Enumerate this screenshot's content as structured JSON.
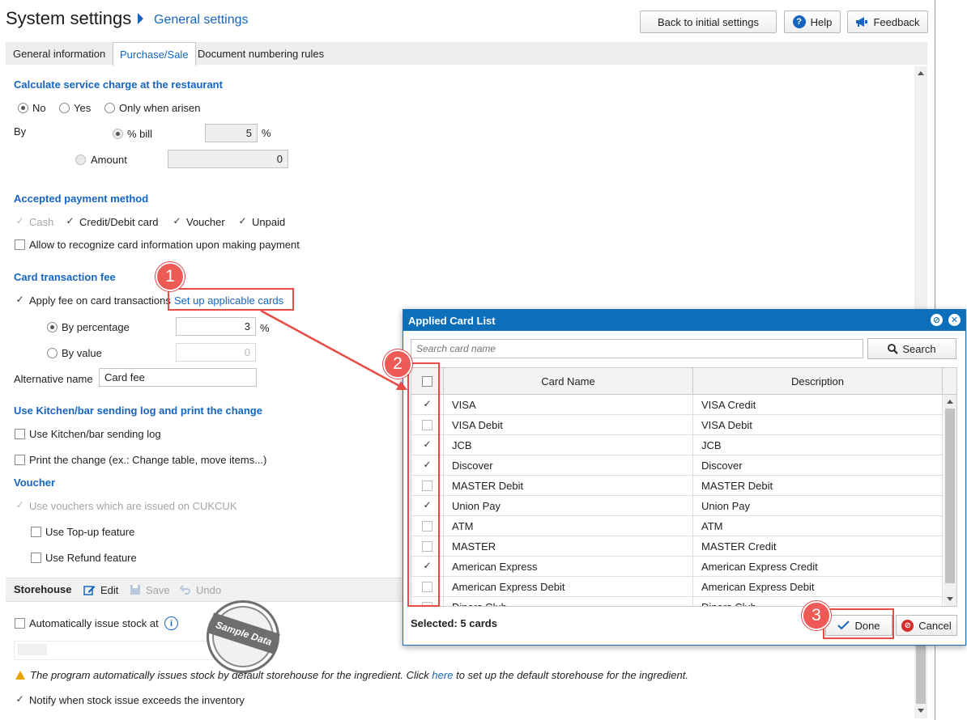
{
  "header": {
    "title": "System settings",
    "breadcrumb": "General settings",
    "back_label": "Back to initial settings",
    "help_label": "Help",
    "help_glyph": "?",
    "feedback_label": "Feedback"
  },
  "tabs": [
    "General information",
    "Purchase/Sale",
    "Document numbering rules"
  ],
  "service_charge": {
    "title": "Calculate service charge at the restaurant",
    "options": [
      "No",
      "Yes",
      "Only when arisen"
    ],
    "by_label": "By",
    "percent_label": "% bill",
    "percent_value": "5",
    "percent_unit": "%",
    "amount_label": "Amount",
    "amount_value": "0"
  },
  "payment": {
    "title": "Accepted payment method",
    "methods": [
      "Cash",
      "Credit/Debit card",
      "Voucher",
      "Unpaid"
    ],
    "recognize_label": "Allow to recognize card information upon making payment"
  },
  "card_fee": {
    "title": "Card transaction fee",
    "apply_label": "Apply fee on card transactions",
    "setup_link": "Set up applicable cards",
    "by_percentage": "By percentage",
    "percentage_value": "3",
    "percentage_unit": "%",
    "by_value": "By value",
    "value_value": "0",
    "alt_name_label": "Alternative name",
    "alt_name_value": "Card fee"
  },
  "kitchen": {
    "title": "Use Kitchen/bar sending log and print the change",
    "use_log": "Use Kitchen/bar sending log",
    "print_change": "Print the change (ex.: Change table, move items...)"
  },
  "voucher": {
    "title": "Voucher",
    "use_vouchers": "Use vouchers which are issued on CUKCUK",
    "topup": "Use Top-up feature",
    "refund": "Use Refund feature"
  },
  "storehouse": {
    "title": "Storehouse",
    "edit": "Edit",
    "save": "Save",
    "undo": "Undo",
    "auto_issue": "Automatically issue stock at",
    "info_glyph": "i",
    "notice_before": "The program automatically issues stock by default storehouse for the ingredient. Click",
    "notice_link": "here",
    "notice_after": "to set up the default storehouse for the ingredient.",
    "notify_label": "Notify when stock issue exceeds the inventory"
  },
  "stamp": {
    "text": "Sample Data"
  },
  "callouts": [
    "1",
    "2",
    "3"
  ],
  "dialog": {
    "title": "Applied Card List",
    "search_placeholder": "Search card name",
    "search_label": "Search",
    "col_name": "Card Name",
    "col_desc": "Description",
    "rows": [
      {
        "name": "VISA",
        "desc": "VISA Credit",
        "checked": true
      },
      {
        "name": "VISA Debit",
        "desc": "VISA Debit",
        "checked": false
      },
      {
        "name": "JCB",
        "desc": "JCB",
        "checked": true
      },
      {
        "name": "Discover",
        "desc": "Discover",
        "checked": true
      },
      {
        "name": "MASTER Debit",
        "desc": "MASTER Debit",
        "checked": false
      },
      {
        "name": "Union Pay",
        "desc": "Union Pay",
        "checked": true
      },
      {
        "name": "ATM",
        "desc": "ATM",
        "checked": false
      },
      {
        "name": "MASTER",
        "desc": "MASTER Credit",
        "checked": false
      },
      {
        "name": "American Express",
        "desc": "American Express Credit",
        "checked": true
      },
      {
        "name": "American Express Debit",
        "desc": "American Express Debit",
        "checked": false
      },
      {
        "name": "Diners Club",
        "desc": "Diners Club",
        "checked": false
      }
    ],
    "selected_label": "Selected: 5 cards",
    "done_label": "Done",
    "cancel_label": "Cancel"
  },
  "colors": {
    "accent": "#1565c0",
    "dialog_header": "#0b6fba",
    "callout": "#ee5a55"
  }
}
